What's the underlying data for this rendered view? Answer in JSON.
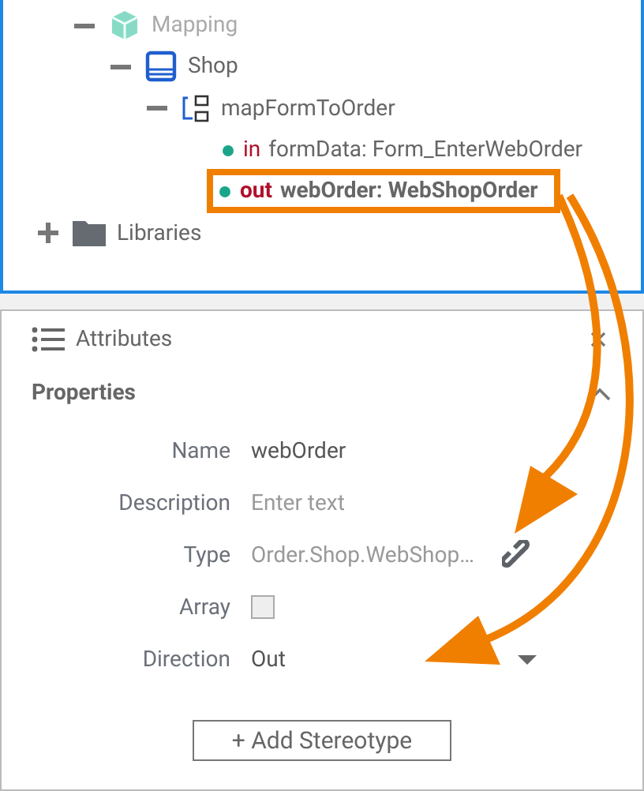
{
  "tree": [
    {
      "children": [
        {
          "label": "Mapping",
          "kind": "package",
          "expanded": true,
          "dimmed": true,
          "children": [
            {
              "label": "Shop",
              "kind": "class",
              "expanded": true,
              "dimmed": false,
              "children": [
                {
                  "label": "mapFormToOrder",
                  "kind": "operation",
                  "expanded": true,
                  "dimmed": false,
                  "children": [
                    {
                      "kind": "parameter",
                      "direction": "in",
                      "label": "formData: Form_EnterWebOrder",
                      "selected": false,
                      "dimmed": false
                    },
                    {
                      "kind": "parameter",
                      "direction": "out",
                      "label": "webOrder: WebShopOrder",
                      "selected": true,
                      "dimmed": false
                    }
                  ]
                }
              ]
            }
          ]
        }
      ]
    },
    {
      "label": "Libraries",
      "kind": "folder",
      "expanded": false,
      "dimmed": false
    }
  ],
  "panel": {
    "title": "Attributes",
    "section": "Properties",
    "expanded": true,
    "fields": [
      {
        "label": "Name",
        "kind": "text",
        "value": "webOrder"
      },
      {
        "label": "Description",
        "kind": "text",
        "placeholder": "Enter text"
      },
      {
        "label": "Type",
        "kind": "link",
        "value": "Order.Shop.WebShop…"
      },
      {
        "label": "Array",
        "kind": "checkbox",
        "checked": false
      },
      {
        "label": "Direction",
        "kind": "dropdown",
        "value": "Out"
      }
    ],
    "button": "+ Add Stereotype"
  }
}
